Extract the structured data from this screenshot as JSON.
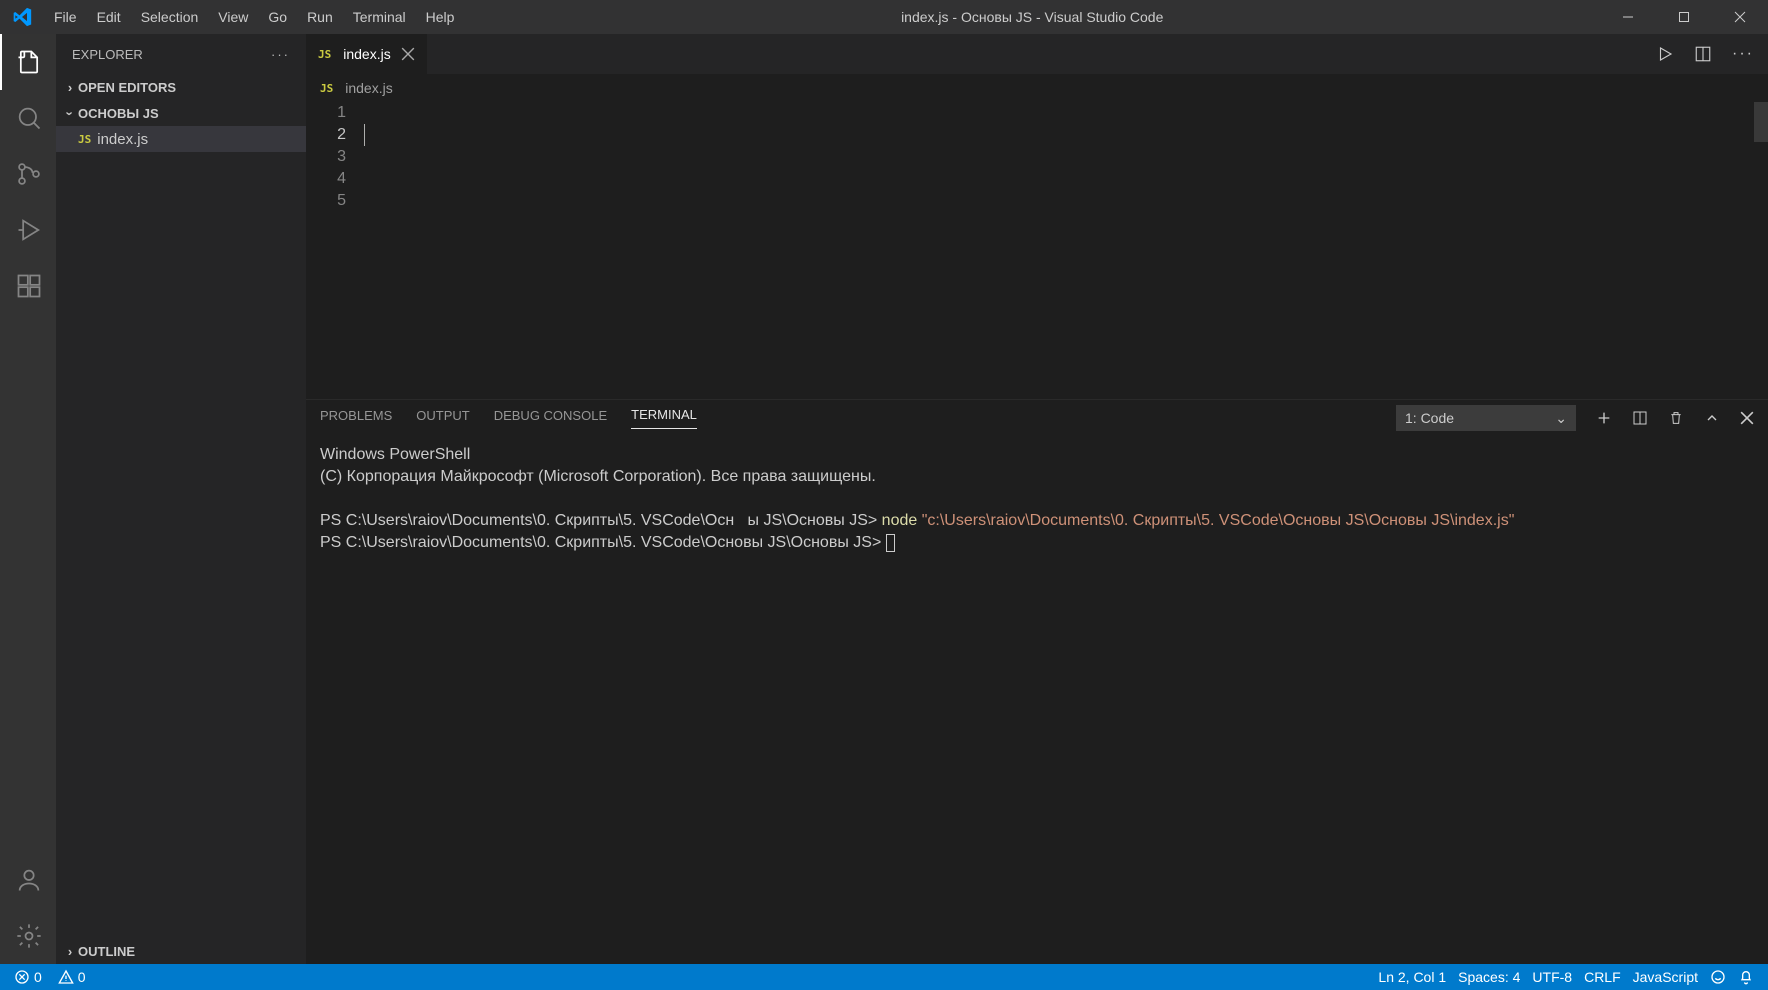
{
  "title": "index.js - Основы JS - Visual Studio Code",
  "menu": [
    "File",
    "Edit",
    "Selection",
    "View",
    "Go",
    "Run",
    "Terminal",
    "Help"
  ],
  "sidebar": {
    "title": "EXPLORER",
    "sections": {
      "openEditors": "OPEN EDITORS",
      "folder": "ОСНОВЫ JS",
      "outline": "OUTLINE"
    },
    "file": "index.js"
  },
  "tab": {
    "name": "index.js"
  },
  "breadcrumb": {
    "file": "index.js"
  },
  "gutter": [
    "1",
    "2",
    "3",
    "4",
    "5"
  ],
  "panel": {
    "tabs": {
      "problems": "PROBLEMS",
      "output": "OUTPUT",
      "debug": "DEBUG CONSOLE",
      "terminal": "TERMINAL"
    },
    "selector": "1: Code"
  },
  "terminal": {
    "l1": "Windows PowerShell",
    "l2": "(C) Корпорация Майкрософт (Microsoft Corporation). Все права защищены.",
    "prompt1": "PS C:\\Users\\raiov\\Documents\\0. Скрипты\\5. VSCode\\Осн   ы JS\\Основы JS> ",
    "cmd": "node ",
    "arg": "\"c:\\Users\\raiov\\Documents\\0. Скрипты\\5. VSCode\\Основы JS\\Основы JS\\index.js\"",
    "prompt2": "PS C:\\Users\\raiov\\Documents\\0. Скрипты\\5. VSCode\\Основы JS\\Основы JS> "
  },
  "status": {
    "errors": "0",
    "warnings": "0",
    "lncol": "Ln 2, Col 1",
    "spaces": "Spaces: 4",
    "encoding": "UTF-8",
    "eol": "CRLF",
    "lang": "JavaScript"
  }
}
